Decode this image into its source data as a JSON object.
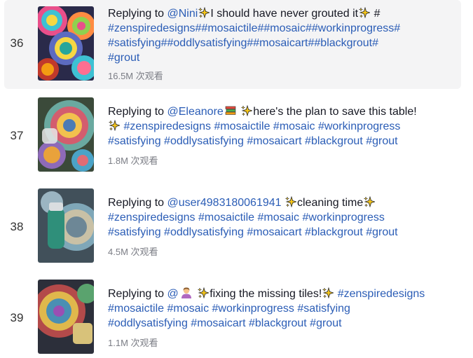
{
  "rows": [
    {
      "rank": "36",
      "prefix": "Replying to ",
      "mention": "@Nini",
      "caption": "I should have never grouted it",
      "hash_after": " #",
      "line2": [
        "#zenspiredesigns",
        "#",
        "#mosaictile",
        "#",
        "#mosaic",
        "#",
        "#workinprogress",
        "#"
      ],
      "line3": [
        "#satisfying",
        "#",
        "#oddlysatisfying",
        "#",
        "#mosaicart",
        "#",
        "#blackgrout",
        "#"
      ],
      "line4": "#grout",
      "views": "16.5M 次观看"
    },
    {
      "rank": "37",
      "prefix": "Replying to ",
      "mention": "@Eleanore",
      "caption": "here's the plan to save this table!",
      "tags": [
        "#zenspiredesigns",
        "#mosaictile",
        "#mosaic",
        "#workinprogress",
        "#satisfying",
        "#oddlysatisfying",
        "#mosaicart",
        "#blackgrout",
        "#grout"
      ],
      "views": "1.8M 次观看"
    },
    {
      "rank": "38",
      "prefix": "Replying to ",
      "mention": "@user4983180061941",
      "caption": "cleaning time",
      "tags": [
        "#zenspiredesigns",
        "#mosaictile",
        "#mosaic",
        "#workinprogress",
        "#satisfying",
        "#oddlysatisfying",
        "#mosaicart",
        "#blackgrout",
        "#grout"
      ],
      "views": "4.5M 次观看"
    },
    {
      "rank": "39",
      "prefix": "Replying to ",
      "mention": "@",
      "caption": "fixing the missing tiles!",
      "tags": [
        "#zenspiredesigns",
        "#mosaictile",
        "#mosaic",
        "#workinprogress",
        "#satisfying",
        "#oddlysatisfying",
        "#mosaicart",
        "#blackgrout",
        "#grout"
      ],
      "views": "1.1M 次观看"
    }
  ],
  "icons": {
    "sparkle": "sparkles-emoji-icon",
    "books": "books-emoji-icon",
    "person": "person-emoji-icon",
    "thumbnail": "video-thumbnail"
  },
  "colors": {
    "hashtag": "#2b5db6",
    "highlight_bg": "#f4f4f5",
    "views": "#7b7d85"
  }
}
